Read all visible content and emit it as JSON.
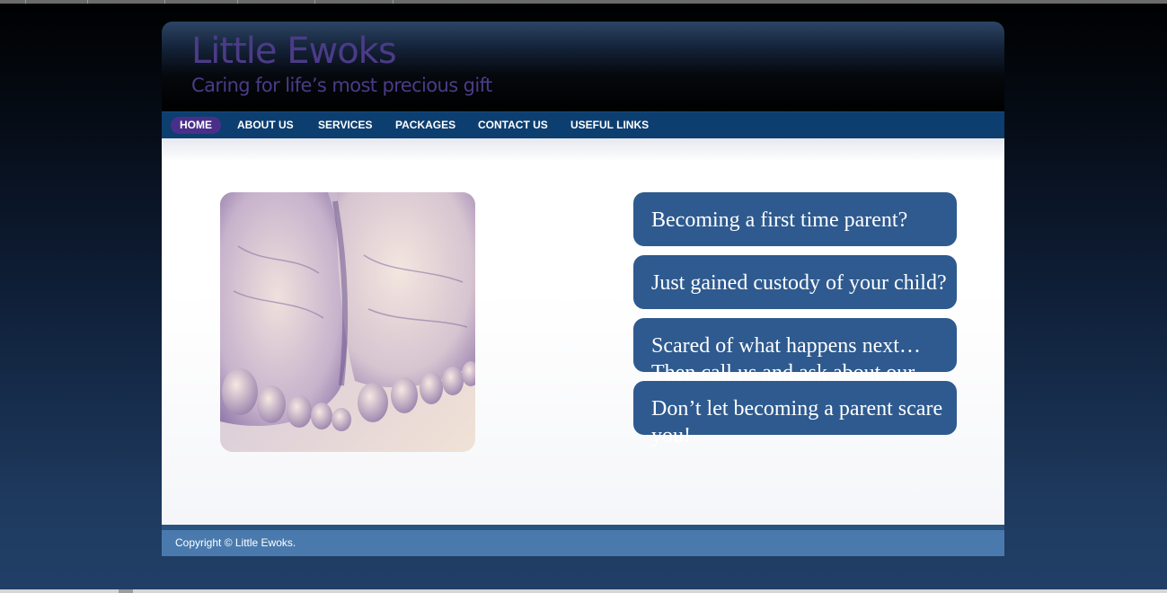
{
  "site": {
    "title": "Little Ewoks",
    "tagline": "Caring for life’s most precious gift"
  },
  "nav": {
    "items": [
      {
        "label": "HOME",
        "active": true
      },
      {
        "label": "ABOUT US"
      },
      {
        "label": "SERVICES"
      },
      {
        "label": "PACKAGES"
      },
      {
        "label": "CONTACT US"
      },
      {
        "label": "USEFUL LINKS"
      }
    ]
  },
  "content": {
    "image": "baby-feet-photo",
    "bubbles": [
      "Becoming a first time parent?",
      "Just gained custody of your child?",
      "Scared of what happens next… Then call us and ask about our one on one information session.",
      "Don’t let becoming a parent scare you!"
    ]
  },
  "footer": {
    "copyright": "Copyright © Little Ewoks."
  },
  "colors": {
    "brand_text": "#4b3b88",
    "nav_bg": "#0d3e70",
    "nav_active": "#4a2f8a",
    "bubble_bg": "#2e5a8f",
    "footer_bg": "#4a7aad"
  }
}
